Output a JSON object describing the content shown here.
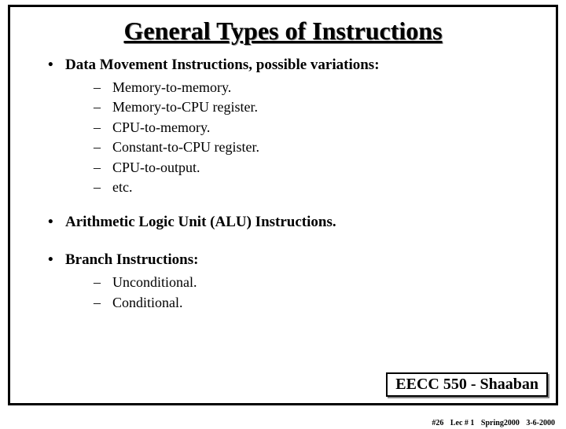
{
  "title": "General Types of Instructions",
  "bullets": {
    "b1": "Data Movement Instructions, possible variations:",
    "sub1": [
      "Memory-to-memory.",
      "Memory-to-CPU register.",
      "CPU-to-memory.",
      "Constant-to-CPU register.",
      "CPU-to-output.",
      "etc."
    ],
    "b2": "Arithmetic Logic Unit (ALU) Instructions.",
    "b3": "Branch Instructions:",
    "sub3": [
      "Unconditional.",
      "Conditional."
    ]
  },
  "footer": {
    "course": "EECC 550 - Shaaban",
    "slide": "#26",
    "lecture": "Lec # 1",
    "term": "Spring2000",
    "date": "3-6-2000"
  }
}
